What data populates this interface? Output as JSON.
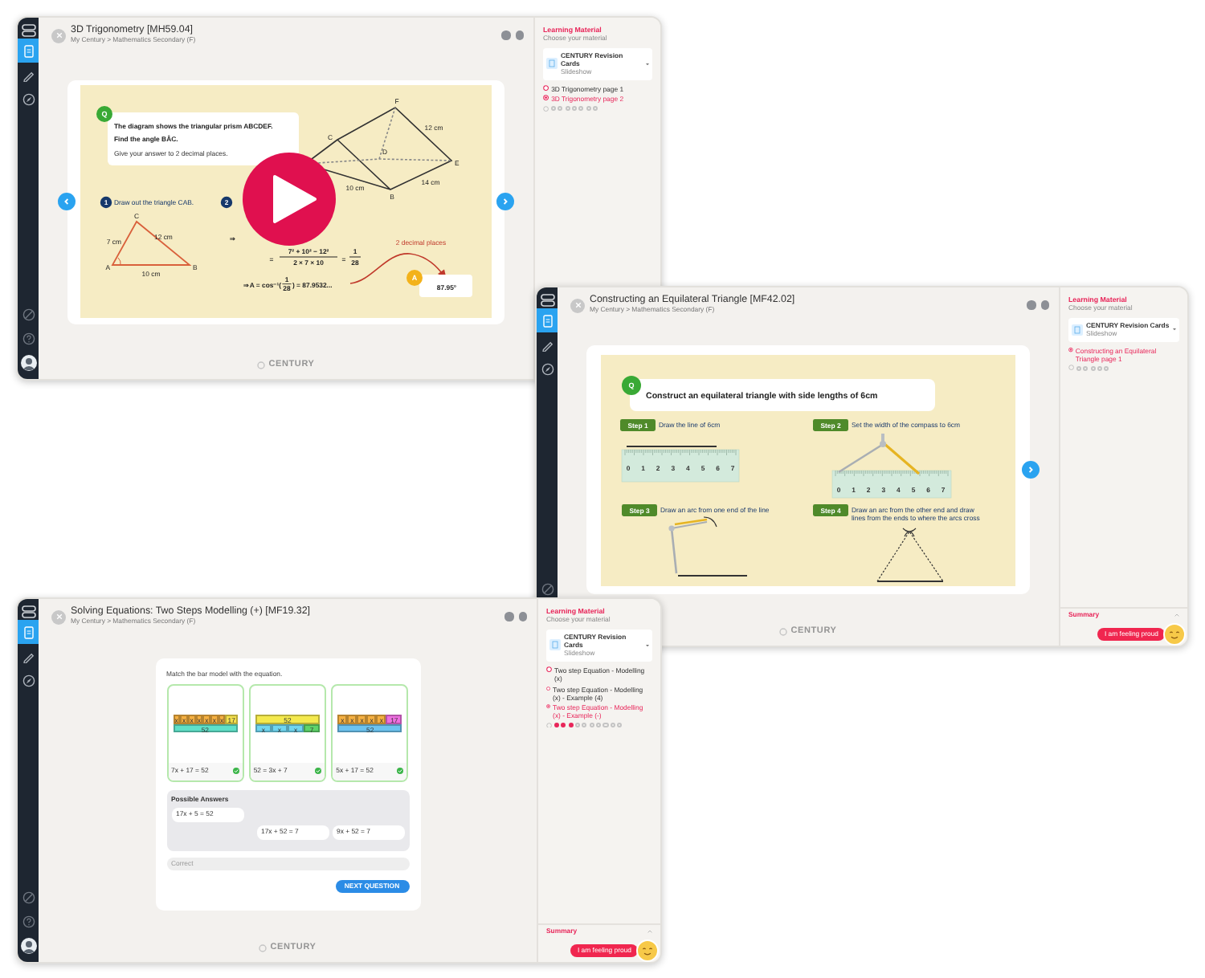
{
  "windows": [
    {
      "kind": "slides",
      "title": "3D Trigonometry [MH59.04]",
      "breadcrumb": "My Century > Mathematics Secondary (F)",
      "nav": [
        {
          "selected": true
        },
        {
          "selected": false
        },
        {
          "selected": false
        }
      ],
      "slide": {
        "kind": "trigonometry",
        "badge": "Q",
        "question": "The diagram shows the triangular prism ABCDEF.",
        "prompt": "Find the angle BÂC.",
        "hint": "Give your answer to 2 decimal places.",
        "steps": [
          {
            "number": "1",
            "text": "Draw out the triangle CAB."
          },
          {
            "number": "2"
          }
        ],
        "prism_labels": [
          "F",
          "C",
          "D",
          "E",
          "B",
          "12 cm",
          "14 cm",
          "10 cm"
        ],
        "triangle_labels": [
          "C",
          "A",
          "B",
          "7 cm",
          "12 cm",
          "10 cm"
        ],
        "implies": "⇒",
        "fraction": {
          "lead": "=",
          "numerator": "7² + 10² − 12²",
          "denominator": "2 × 7 × 10",
          "equals": "=",
          "result_numerator": "1",
          "result_denominator": "28"
        },
        "result": {
          "prefix": "⇒ A = cos⁻¹(",
          "numerator": "1",
          "denominator": "28",
          "suffix": ") = 87.9532..."
        },
        "note": "2 decimal places",
        "answer_badge": "A",
        "answer": "87.95°",
        "play_button": true,
        "prev_arrow": true,
        "next_arrow": true
      },
      "panel": {
        "title": "Learning Material",
        "subtitle": "Choose your material",
        "material": {
          "name": "CENTURY Revision Cards",
          "type": "Slideshow"
        },
        "pages": [
          {
            "label": "3D Trigonometry page 1",
            "selected": false
          },
          {
            "label": "3D Trigonometry page 2",
            "selected": true
          }
        ],
        "steps": [
          {
            "done": false
          },
          {
            "done": false
          },
          {
            "done": false
          },
          {
            "done": false
          },
          {
            "done": false
          },
          {
            "done": false
          },
          {
            "done": false
          }
        ]
      },
      "footer": "CENTURY"
    },
    {
      "kind": "slides",
      "title": "Constructing an Equilateral Triangle [MF42.02]",
      "breadcrumb": "My Century > Mathematics Secondary (F)",
      "nav": [
        {
          "selected": true
        },
        {
          "selected": false
        },
        {
          "selected": false
        }
      ],
      "slide": {
        "kind": "construction",
        "badge": "Q",
        "question": "Construct an equilateral triangle with side lengths of 6cm",
        "steps": [
          {
            "label": "Step 1",
            "lines": [
              "Draw the line of 6cm"
            ]
          },
          {
            "label": "Step 2",
            "lines": [
              "Set the width of the compass to 6cm"
            ]
          },
          {
            "label": "Step 3",
            "lines": [
              "Draw an arc from one end of the line"
            ]
          },
          {
            "label": "Step 4",
            "lines": [
              "Draw an arc from the other end and draw",
              "lines from the ends to where the arcs cross"
            ]
          }
        ],
        "rulers": [
          {
            "marks": [
              "0",
              "1",
              "2",
              "3",
              "4",
              "5",
              "6",
              "7"
            ]
          },
          {
            "marks": [
              "0",
              "1",
              "2",
              "3",
              "4",
              "5",
              "6",
              "7"
            ]
          }
        ],
        "next_arrow": true
      },
      "panel": {
        "title": "Learning Material",
        "subtitle": "Choose your material",
        "material": {
          "name": "CENTURY Revision Cards",
          "type": "Slideshow"
        },
        "pages": [
          {
            "label": "Constructing an Equilateral Triangle page 1",
            "selected": true
          }
        ],
        "steps": [
          {
            "done": false
          },
          {
            "done": false
          },
          {
            "done": false
          },
          {
            "done": false
          },
          {
            "done": false
          }
        ],
        "summary": "Summary"
      },
      "feedback_button": "I am feeling proud",
      "footer": "CENTURY"
    },
    {
      "kind": "quiz",
      "title": "Solving Equations: Two Steps Modelling (+) [MF19.32]",
      "breadcrumb": "My Century > Mathematics Secondary (F)",
      "nav": [
        {
          "selected": true
        },
        {
          "selected": false
        },
        {
          "selected": false
        }
      ],
      "quiz": {
        "instruction": "Match the bar model with the equation.",
        "cards": [
          {
            "top": [
              {
                "text": "x",
                "color": "#f5b041"
              },
              {
                "text": "x",
                "color": "#f5b041"
              },
              {
                "text": "x",
                "color": "#f5b041"
              },
              {
                "text": "x",
                "color": "#f5b041"
              },
              {
                "text": "x",
                "color": "#f5b041"
              },
              {
                "text": "x",
                "color": "#f5b041"
              },
              {
                "text": "x",
                "color": "#f5b041"
              },
              {
                "text": "17",
                "color": "#f4e04d"
              }
            ],
            "bottom": [
              {
                "text": "52",
                "color": "#5fe0c8"
              }
            ],
            "equation": "7x + 17 = 52",
            "correct": true
          },
          {
            "top": [
              {
                "text": "52",
                "color": "#f4e94d"
              }
            ],
            "bottom": [
              {
                "text": "x",
                "color": "#6fd6f0"
              },
              {
                "text": "x",
                "color": "#6fd6f0"
              },
              {
                "text": "x",
                "color": "#6fd6f0"
              },
              {
                "text": "7",
                "color": "#5fd36a"
              }
            ],
            "equation": "52 = 3x + 7",
            "correct": true
          },
          {
            "top": [
              {
                "text": "x",
                "color": "#f5b041"
              },
              {
                "text": "x",
                "color": "#f5b041"
              },
              {
                "text": "x",
                "color": "#f5b041"
              },
              {
                "text": "x",
                "color": "#f5b041"
              },
              {
                "text": "x",
                "color": "#f5b041"
              },
              {
                "text": "17",
                "color": "#ee6fe0"
              }
            ],
            "bottom": [
              {
                "text": "52",
                "color": "#6cc3f0"
              }
            ],
            "equation": "5x + 17 = 52",
            "correct": true
          }
        ],
        "answers_title": "Possible Answers",
        "answers": [
          "17x + 5 = 52",
          "17x + 52 = 7",
          "9x + 52 = 7"
        ],
        "feedback": "Correct",
        "button": "NEXT QUESTION"
      },
      "panel": {
        "title": "Learning Material",
        "subtitle": "Choose your material",
        "material": {
          "name": "CENTURY Revision Cards",
          "type": "Slideshow"
        },
        "pages": [
          {
            "label": "Two step Equation - Modelling (x)",
            "selected": false
          },
          {
            "label": "Two step Equation - Modelling (x) - Example (4)",
            "selected": false
          },
          {
            "label": "Two step Equation - Modelling (x) - Example (-)",
            "selected": true
          }
        ],
        "steps": [
          {
            "done": true
          },
          {
            "done": true
          },
          {
            "done": true
          },
          {
            "done": false
          },
          {
            "done": false
          },
          {
            "done": false
          },
          {
            "done": false
          },
          {
            "done": false
          },
          {
            "done": false
          },
          {
            "done": false
          }
        ],
        "summary": "Summary"
      },
      "feedback_button": "I am feeling proud",
      "footer": "CENTURY"
    }
  ]
}
